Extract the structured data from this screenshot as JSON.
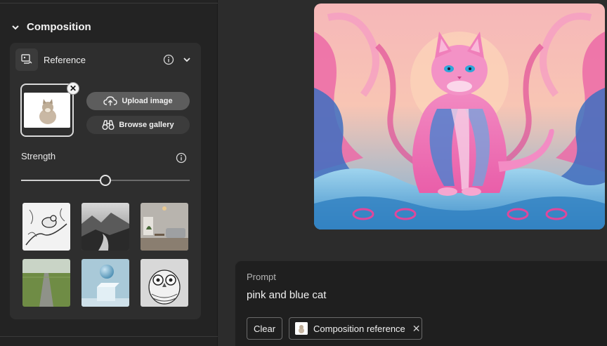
{
  "sidebar": {
    "section_title": "Composition",
    "reference": {
      "label": "Reference",
      "upload_label": "Upload image",
      "gallery_label": "Browse gallery"
    },
    "strength": {
      "label": "Strength",
      "value_fraction": 0.5
    },
    "gallery_tiles": [
      "bird-sketch-tile",
      "mountain-river-tile",
      "living-room-tile",
      "road-field-tile",
      "sphere-cube-tile",
      "owl-sketch-tile"
    ]
  },
  "prompt": {
    "label": "Prompt",
    "text": "pink and blue cat",
    "clear_label": "Clear",
    "chip_label": "Composition reference"
  },
  "colors": {
    "sidebar_bg": "#232323",
    "panel_bg": "#2e2e2e",
    "canvas_bg": "#2c2c2c",
    "prompt_bg": "#1f1f1f",
    "upload_btn": "#5d5d5d"
  },
  "icons": [
    "chevron-down-icon",
    "reference-icon",
    "info-icon",
    "upload-cloud-icon",
    "binoculars-icon",
    "close-icon"
  ]
}
